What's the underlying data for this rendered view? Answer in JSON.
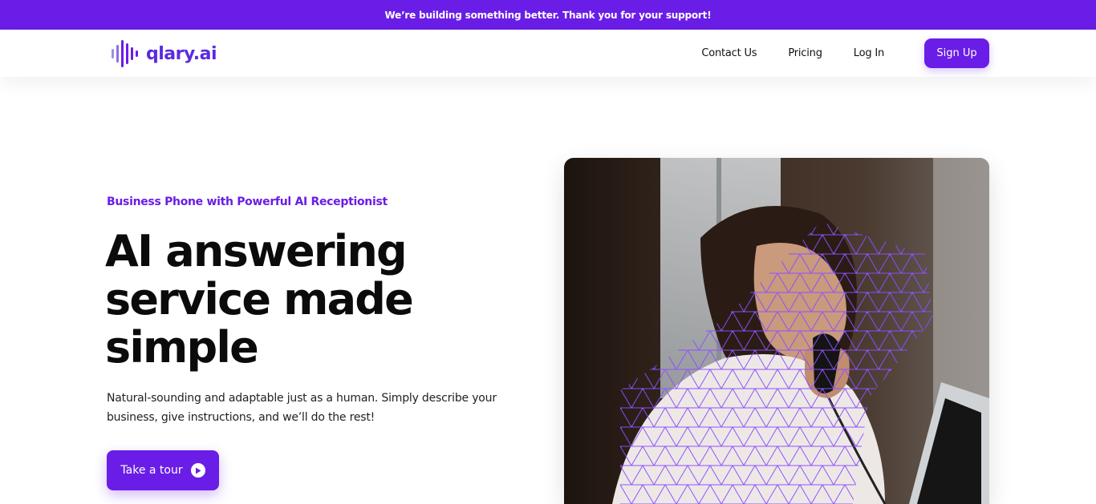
{
  "banner": {
    "text": "We’re building something better. Thank you for your support!"
  },
  "brand": {
    "name": "qlary.ai",
    "accent": "#6a1de6"
  },
  "nav": {
    "links": [
      "Contact Us",
      "Pricing",
      "Log In"
    ],
    "signup_label": "Sign Up"
  },
  "hero": {
    "eyebrow": "Business Phone with Powerful AI Receptionist",
    "headline": "AI answering service made simple",
    "subtext": "Natural-sounding and adaptable just as a human. Simply describe your business, give instructions, and we’ll do the rest!",
    "cta_label": "Take a tour",
    "cta_icon": "play-circle-icon",
    "image": "woman-on-phone-photo"
  }
}
